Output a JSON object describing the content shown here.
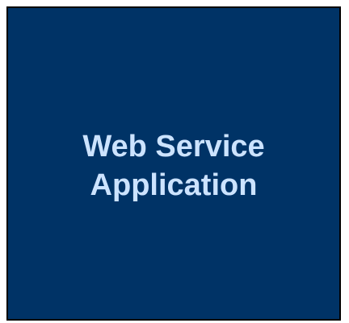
{
  "box": {
    "lines": [
      "Web Service",
      "Application"
    ],
    "background_color": "#003366",
    "text_color": "#cce3ff"
  }
}
